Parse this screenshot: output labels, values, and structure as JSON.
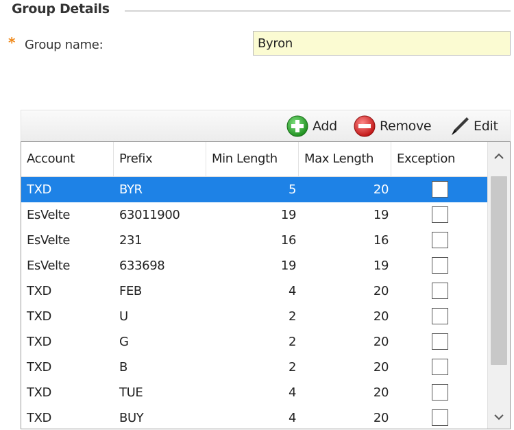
{
  "section": {
    "title": "Group Details"
  },
  "group_name": {
    "label": "Group name:",
    "required_marker": "*",
    "value": "Byron"
  },
  "toolbar": {
    "add_label": "Add",
    "remove_label": "Remove",
    "edit_label": "Edit"
  },
  "icons": {
    "add": "plus-circle-icon",
    "remove": "minus-circle-icon",
    "edit": "pen-icon"
  },
  "colors": {
    "selected_row": "#1e82e6",
    "input_bg": "#fbfbd2",
    "required": "#f08a1c",
    "add": "#2aa72a",
    "remove": "#d62020"
  },
  "grid": {
    "columns": [
      "Account",
      "Prefix",
      "Min Length",
      "Max Length",
      "Exception"
    ],
    "rows": [
      {
        "account": "TXD",
        "prefix": "BYR",
        "min": "5",
        "max": "20",
        "exception": false,
        "selected": true
      },
      {
        "account": "EsVelte",
        "prefix": "63011900",
        "min": "19",
        "max": "19",
        "exception": false
      },
      {
        "account": "EsVelte",
        "prefix": "231",
        "min": "16",
        "max": "16",
        "exception": false
      },
      {
        "account": "EsVelte",
        "prefix": "633698",
        "min": "19",
        "max": "19",
        "exception": false
      },
      {
        "account": "TXD",
        "prefix": "FEB",
        "min": "4",
        "max": "20",
        "exception": false
      },
      {
        "account": "TXD",
        "prefix": "U",
        "min": "2",
        "max": "20",
        "exception": false
      },
      {
        "account": "TXD",
        "prefix": "G",
        "min": "2",
        "max": "20",
        "exception": false
      },
      {
        "account": "TXD",
        "prefix": "B",
        "min": "2",
        "max": "20",
        "exception": false
      },
      {
        "account": "TXD",
        "prefix": "TUE",
        "min": "4",
        "max": "20",
        "exception": false
      },
      {
        "account": "TXD",
        "prefix": "BUY",
        "min": "4",
        "max": "20",
        "exception": false
      }
    ]
  }
}
